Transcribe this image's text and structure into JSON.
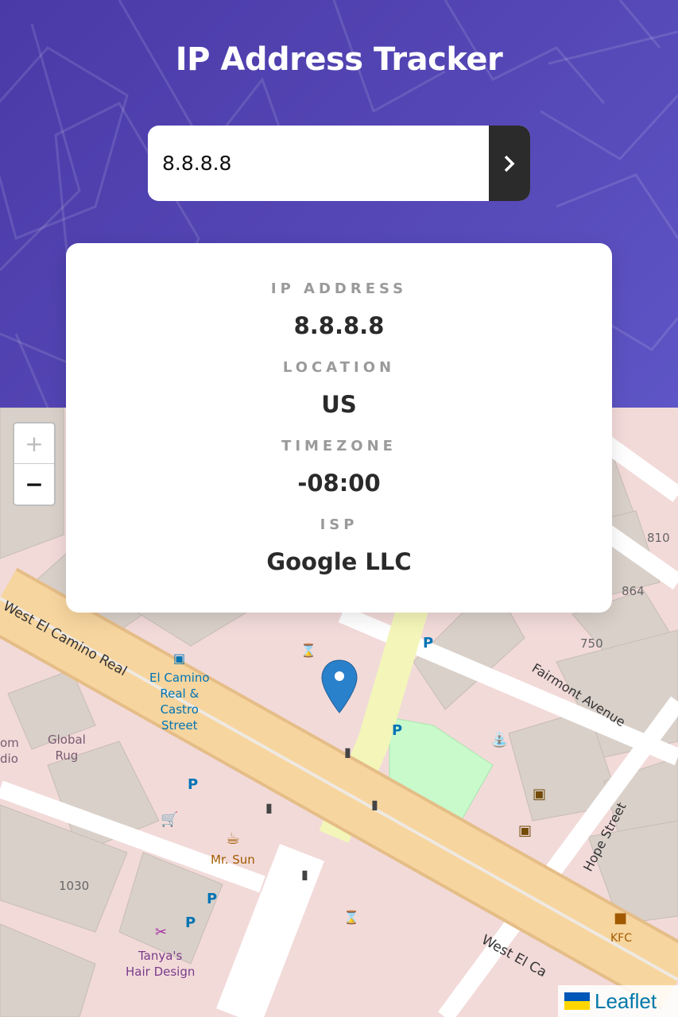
{
  "header": {
    "title": "IP Address Tracker"
  },
  "search": {
    "value": "8.8.8.8",
    "submit_icon": "chevron-right-icon"
  },
  "info": {
    "ip_label": "IP ADDRESS",
    "ip_value": "8.8.8.8",
    "location_label": "LOCATION",
    "location_value": "US",
    "timezone_label": "TIMEZONE",
    "timezone_value": "-08:00",
    "isp_label": "ISP",
    "isp_value": "Google LLC"
  },
  "map": {
    "zoom_in": "+",
    "zoom_out": "−",
    "streets": {
      "west_el_camino_top": "West El Camino Real",
      "west_el_camino_bottom": "West El Ca",
      "fairmont": "Fairmont Avenue",
      "hope": "Hope Street"
    },
    "pois": {
      "el_camino_stop_1": "El Camino",
      "el_camino_stop_2": "Real &",
      "el_camino_stop_3": "Castro",
      "el_camino_stop_4": "Street",
      "global_rug_1": "Global",
      "global_rug_2": "Rug",
      "mr_sun": "Mr. Sun",
      "tanya_1": "Tanya's",
      "tanya_2": "Hair Design",
      "kfc": "KFC",
      "om": "om",
      "dio": "dio"
    },
    "house_numbers": {
      "n810": "810",
      "n864": "864",
      "n750": "750",
      "n1030": "1030"
    },
    "attribution": "Leaflet"
  },
  "colors": {
    "hero_accent": "#4e42b0",
    "road_major": "#f7d59e",
    "road_minor": "#ffffff",
    "building": "#d9d0c9",
    "landuse": "#f2dad9",
    "park": "#c8facc",
    "footway": "#f3f6b8",
    "marker": "#2a81cb",
    "leaflet_link": "#0078a8"
  }
}
